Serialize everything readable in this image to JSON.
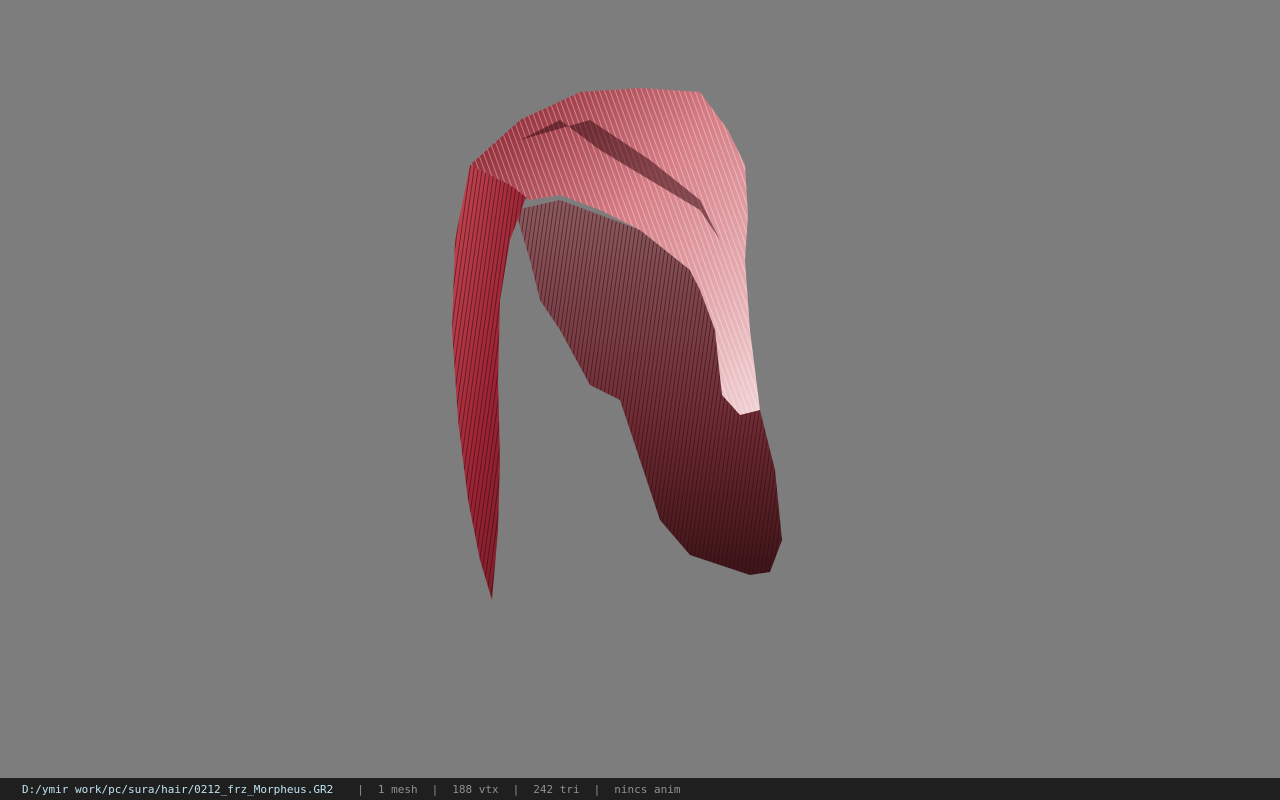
{
  "viewer": {
    "background_color": "#7d7d7d",
    "model_icon": "hair-mesh-render",
    "hair_colors": [
      "#b52b3a",
      "#e9b2b6",
      "#2a1012"
    ]
  },
  "status": {
    "path": "D:/ymir work/pc/sura/hair/0212_frz_Morpheus.GR2",
    "separator": "|",
    "mesh": "1 mesh",
    "vtx": "188 vtx",
    "tri": "242 tri",
    "anim": "nincs anim"
  }
}
